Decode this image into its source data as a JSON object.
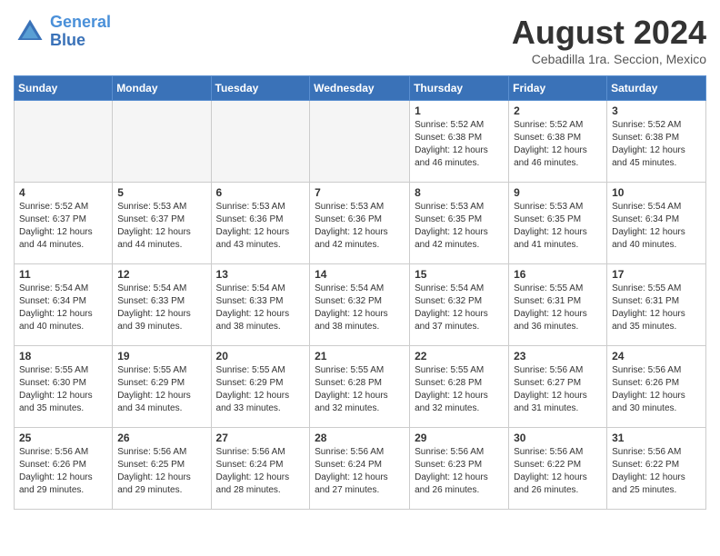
{
  "header": {
    "logo_line1": "General",
    "logo_line2": "Blue",
    "month": "August 2024",
    "location": "Cebadilla 1ra. Seccion, Mexico"
  },
  "days_of_week": [
    "Sunday",
    "Monday",
    "Tuesday",
    "Wednesday",
    "Thursday",
    "Friday",
    "Saturday"
  ],
  "weeks": [
    [
      {
        "day": "",
        "info": ""
      },
      {
        "day": "",
        "info": ""
      },
      {
        "day": "",
        "info": ""
      },
      {
        "day": "",
        "info": ""
      },
      {
        "day": "1",
        "info": "Sunrise: 5:52 AM\nSunset: 6:38 PM\nDaylight: 12 hours\nand 46 minutes."
      },
      {
        "day": "2",
        "info": "Sunrise: 5:52 AM\nSunset: 6:38 PM\nDaylight: 12 hours\nand 46 minutes."
      },
      {
        "day": "3",
        "info": "Sunrise: 5:52 AM\nSunset: 6:38 PM\nDaylight: 12 hours\nand 45 minutes."
      }
    ],
    [
      {
        "day": "4",
        "info": "Sunrise: 5:52 AM\nSunset: 6:37 PM\nDaylight: 12 hours\nand 44 minutes."
      },
      {
        "day": "5",
        "info": "Sunrise: 5:53 AM\nSunset: 6:37 PM\nDaylight: 12 hours\nand 44 minutes."
      },
      {
        "day": "6",
        "info": "Sunrise: 5:53 AM\nSunset: 6:36 PM\nDaylight: 12 hours\nand 43 minutes."
      },
      {
        "day": "7",
        "info": "Sunrise: 5:53 AM\nSunset: 6:36 PM\nDaylight: 12 hours\nand 42 minutes."
      },
      {
        "day": "8",
        "info": "Sunrise: 5:53 AM\nSunset: 6:35 PM\nDaylight: 12 hours\nand 42 minutes."
      },
      {
        "day": "9",
        "info": "Sunrise: 5:53 AM\nSunset: 6:35 PM\nDaylight: 12 hours\nand 41 minutes."
      },
      {
        "day": "10",
        "info": "Sunrise: 5:54 AM\nSunset: 6:34 PM\nDaylight: 12 hours\nand 40 minutes."
      }
    ],
    [
      {
        "day": "11",
        "info": "Sunrise: 5:54 AM\nSunset: 6:34 PM\nDaylight: 12 hours\nand 40 minutes."
      },
      {
        "day": "12",
        "info": "Sunrise: 5:54 AM\nSunset: 6:33 PM\nDaylight: 12 hours\nand 39 minutes."
      },
      {
        "day": "13",
        "info": "Sunrise: 5:54 AM\nSunset: 6:33 PM\nDaylight: 12 hours\nand 38 minutes."
      },
      {
        "day": "14",
        "info": "Sunrise: 5:54 AM\nSunset: 6:32 PM\nDaylight: 12 hours\nand 38 minutes."
      },
      {
        "day": "15",
        "info": "Sunrise: 5:54 AM\nSunset: 6:32 PM\nDaylight: 12 hours\nand 37 minutes."
      },
      {
        "day": "16",
        "info": "Sunrise: 5:55 AM\nSunset: 6:31 PM\nDaylight: 12 hours\nand 36 minutes."
      },
      {
        "day": "17",
        "info": "Sunrise: 5:55 AM\nSunset: 6:31 PM\nDaylight: 12 hours\nand 35 minutes."
      }
    ],
    [
      {
        "day": "18",
        "info": "Sunrise: 5:55 AM\nSunset: 6:30 PM\nDaylight: 12 hours\nand 35 minutes."
      },
      {
        "day": "19",
        "info": "Sunrise: 5:55 AM\nSunset: 6:29 PM\nDaylight: 12 hours\nand 34 minutes."
      },
      {
        "day": "20",
        "info": "Sunrise: 5:55 AM\nSunset: 6:29 PM\nDaylight: 12 hours\nand 33 minutes."
      },
      {
        "day": "21",
        "info": "Sunrise: 5:55 AM\nSunset: 6:28 PM\nDaylight: 12 hours\nand 32 minutes."
      },
      {
        "day": "22",
        "info": "Sunrise: 5:55 AM\nSunset: 6:28 PM\nDaylight: 12 hours\nand 32 minutes."
      },
      {
        "day": "23",
        "info": "Sunrise: 5:56 AM\nSunset: 6:27 PM\nDaylight: 12 hours\nand 31 minutes."
      },
      {
        "day": "24",
        "info": "Sunrise: 5:56 AM\nSunset: 6:26 PM\nDaylight: 12 hours\nand 30 minutes."
      }
    ],
    [
      {
        "day": "25",
        "info": "Sunrise: 5:56 AM\nSunset: 6:26 PM\nDaylight: 12 hours\nand 29 minutes."
      },
      {
        "day": "26",
        "info": "Sunrise: 5:56 AM\nSunset: 6:25 PM\nDaylight: 12 hours\nand 29 minutes."
      },
      {
        "day": "27",
        "info": "Sunrise: 5:56 AM\nSunset: 6:24 PM\nDaylight: 12 hours\nand 28 minutes."
      },
      {
        "day": "28",
        "info": "Sunrise: 5:56 AM\nSunset: 6:24 PM\nDaylight: 12 hours\nand 27 minutes."
      },
      {
        "day": "29",
        "info": "Sunrise: 5:56 AM\nSunset: 6:23 PM\nDaylight: 12 hours\nand 26 minutes."
      },
      {
        "day": "30",
        "info": "Sunrise: 5:56 AM\nSunset: 6:22 PM\nDaylight: 12 hours\nand 26 minutes."
      },
      {
        "day": "31",
        "info": "Sunrise: 5:56 AM\nSunset: 6:22 PM\nDaylight: 12 hours\nand 25 minutes."
      }
    ]
  ]
}
